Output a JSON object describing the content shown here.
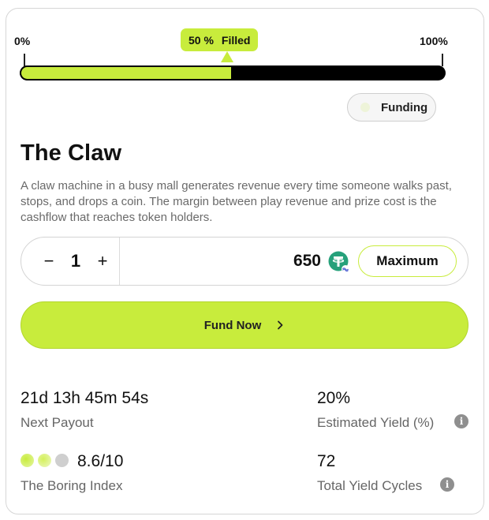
{
  "progress": {
    "min_label": "0%",
    "max_label": "100%",
    "percent_text": "50 %",
    "filled_label": "Filled",
    "fill_fraction": 0.5
  },
  "status": {
    "label": "Funding"
  },
  "project": {
    "title": "The Claw",
    "description": "A claw machine in a busy mall generates revenue every time someone walks past, stops, and drops a coin. The margin between play revenue and prize cost is the cashflow that reaches token holders."
  },
  "purchase": {
    "minus_label": "−",
    "quantity": "1",
    "plus_label": "+",
    "amount": "650",
    "token_icon": "tether-usdt-icon",
    "max_label": "Maximum"
  },
  "fund_button": {
    "label": "Fund Now"
  },
  "stats": {
    "next_payout_value": "21d 13h 45m 54s",
    "next_payout_label": "Next Payout",
    "estimated_yield_value": "20%",
    "estimated_yield_label": "Estimated Yield (%)",
    "boring_index_value": "8.6/10",
    "boring_index_label": "The Boring Index",
    "total_cycles_value": "72",
    "total_cycles_label": "Total Yield Cycles",
    "info_icon": "i"
  },
  "colors": {
    "accent": "#c8ec3c",
    "track": "#000000",
    "token": "#26a17b"
  }
}
